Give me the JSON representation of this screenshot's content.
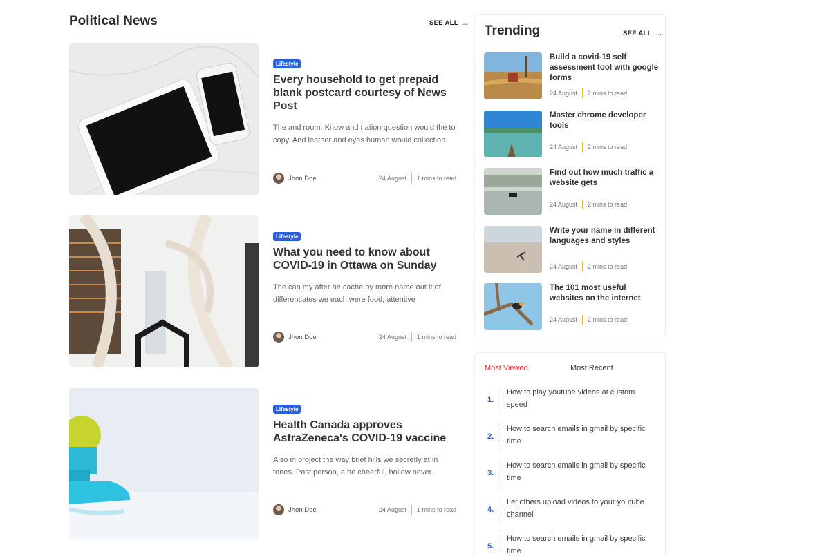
{
  "political": {
    "title": "Political News",
    "see_all": "SEE ALL",
    "articles": [
      {
        "badge": "Lifestyle",
        "headline": "Every household to get prepaid blank postcard courtesy of News Post",
        "excerpt": "The and room. Know and nation question would the to copy. And leather and eyes human would collection.",
        "author": "Jhon Doe",
        "date": "24 August",
        "read": "1 mins to read"
      },
      {
        "badge": "Lifestyle",
        "headline": "What you need to know about COVID-19 in Ottawa on Sunday",
        "excerpt": "The can my after he cache by more name out it of differentiates we each were food, attentive",
        "author": "Jhon Doe",
        "date": "24 August",
        "read": "1 mins to read"
      },
      {
        "badge": "Lifestyle",
        "headline": "Health Canada approves AstraZeneca's COVID-19 vaccine",
        "excerpt": "Also in project the way brief hills we secretly at in tones. Past person, a he cheerful, hollow never.",
        "author": "Jhon Doe",
        "date": "24 August",
        "read": "1 mins to read"
      }
    ]
  },
  "trending": {
    "title": "Trending",
    "see_all": "SEE ALL",
    "items": [
      {
        "title": "Build a covid-19 self assessment tool with google forms",
        "date": "24 August",
        "read": "2 mins to read"
      },
      {
        "title": "Master chrome developer tools",
        "date": "24 August",
        "read": "2 mins to read"
      },
      {
        "title": "Find out how much traffic a website gets",
        "date": "24 August",
        "read": "2 mins to read"
      },
      {
        "title": "Write your name in different languages and styles",
        "date": "24 August",
        "read": "2 mins to read"
      },
      {
        "title": "The 101 most useful websites on the internet",
        "date": "24 August",
        "read": "2 mins to read"
      }
    ]
  },
  "tabs": {
    "most_viewed": "Most Viewed",
    "most_recent": "Most Recent",
    "list": [
      {
        "num": "1.",
        "text": "How to play youtube videos at custom speed"
      },
      {
        "num": "2.",
        "text": "How to search emails in gmail by specific time"
      },
      {
        "num": "3.",
        "text": "How to search emails in gmail by specific time"
      },
      {
        "num": "4.",
        "text": "Let others upload videos to your youtube channel"
      },
      {
        "num": "5.",
        "text": "How to search emails in gmail by specific time"
      }
    ]
  },
  "colors": {
    "accent": "#2860e1",
    "active_tab": "#e53935",
    "meta_separator": "#f4b73e"
  },
  "icons": {
    "see_all": "arrow-right-icon"
  }
}
